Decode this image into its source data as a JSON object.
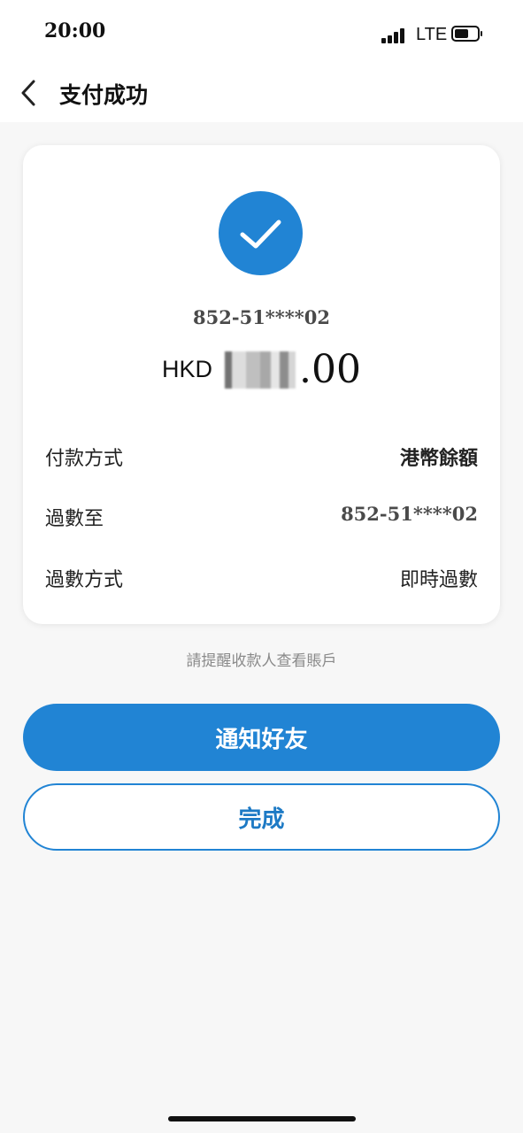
{
  "status_bar": {
    "time": "20:00",
    "network": "LTE",
    "icons": [
      "signal-icon",
      "battery-icon"
    ]
  },
  "header": {
    "back_icon": "chevron-left-icon",
    "title": "支付成功"
  },
  "result": {
    "icon": "checkmark-icon",
    "recipient_account": "852-51****02",
    "currency": "HKD",
    "amount_tail": ".00",
    "amount_obscured": true
  },
  "details": [
    {
      "label": "付款方式",
      "value": "港幣餘額"
    },
    {
      "label": "過數至",
      "value": "852-51****02"
    },
    {
      "label": "過數方式",
      "value": "即時過數"
    }
  ],
  "reminder": "請提醒收款人查看賬戶",
  "actions": {
    "notify_label": "通知好友",
    "done_label": "完成"
  },
  "colors": {
    "accent": "#2184d4",
    "background": "#f7f7f7",
    "card": "#ffffff"
  }
}
